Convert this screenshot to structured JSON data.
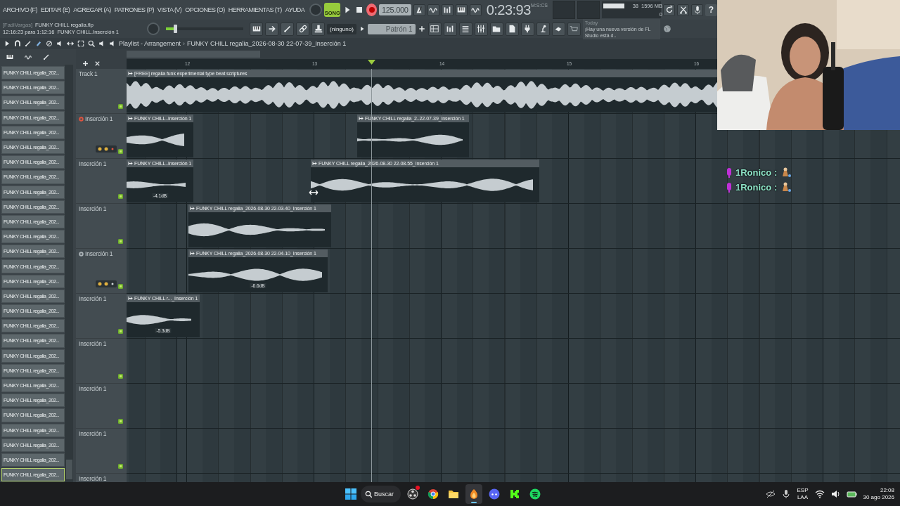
{
  "menu": [
    {
      "label": "ARCHIVO (F)"
    },
    {
      "label": "EDITAR (E)"
    },
    {
      "label": "AGREGAR (A)"
    },
    {
      "label": "PATRONES (P)"
    },
    {
      "label": "VISTA (V)"
    },
    {
      "label": "OPCIONES (O)"
    },
    {
      "label": "HERRAMIENTAS (T)"
    },
    {
      "label": "AYUDA"
    }
  ],
  "transport": {
    "mode": "SONG",
    "song_mode": true,
    "record_armed": true,
    "tempo": "125.000",
    "time": "0:23:93",
    "time_format": "M:S:CS"
  },
  "monitor": {
    "reading_1": "38",
    "memory": "1596 MB",
    "reading_2": "0"
  },
  "help": "?",
  "file": {
    "owner": "[FadiVargas]",
    "title": "FUNKY CHILL regalia.flp",
    "time_info": "12:16:23 para 1:12:16",
    "hint": "FUNKY CHILL.Inserción 1"
  },
  "main_slider": {
    "level": 0.12
  },
  "snap": "(ninguno)",
  "pattern": "Patrón 1",
  "news": {
    "day": "Today",
    "text": "¡Hay una nueva versión de FL Studio está d.."
  },
  "playlist": {
    "title": "Playlist - Arrangement",
    "separator": "›",
    "path": "FUNKY CHILL regalia_2026-08-30 22-07-39_Inserción 1",
    "bars": [
      "12",
      "13",
      "14",
      "15",
      "16"
    ],
    "tracks": [
      {
        "name": "Track 1",
        "clips": [
          {
            "label": "[FREE] regalia  funk  experimental type beat  scriptures"
          }
        ]
      },
      {
        "name": "Inserción 1",
        "record_armed": true,
        "clips": [
          {
            "label": "FUNKY CHILL..Inserción 1"
          },
          {
            "label": "FUNKY CHILL regalia_2..22-07-39_Inserción 1"
          }
        ]
      },
      {
        "name": "Inserción 1",
        "clips": [
          {
            "label": "FUNKY CHILL..Inserción 1",
            "gain": "-4.1dB"
          },
          {
            "label": "FUNKY CHILL regalia_2026-08-30 22-08-55_Inserción 1"
          }
        ]
      },
      {
        "name": "Inserción 1",
        "clips": [
          {
            "label": "FUNKY CHILL regalia_2026-08-30 22-03-40_Inserción 1"
          }
        ]
      },
      {
        "name": "Inserción 1",
        "record_armed": false,
        "clips": [
          {
            "label": "FUNKY CHILL regalia_2026-08-30 22-04-10_Inserción 1",
            "gain": "-6.6dB"
          }
        ]
      },
      {
        "name": "Inserción 1",
        "clips": [
          {
            "label": "FUNKY CHILL r..._Inserción 1",
            "gain": "-5.3dB"
          }
        ]
      },
      {
        "name": "Inserción 1"
      },
      {
        "name": "Inserción 1"
      },
      {
        "name": "Inserción 1"
      },
      {
        "name": "Inserción 1"
      }
    ]
  },
  "browser": {
    "items": [
      {
        "label": "FUNKY CHILL regalia_202...",
        "selected": false
      },
      {
        "label": "FUNKY CHILL regalia_202...",
        "selected": false
      },
      {
        "label": "FUNKY CHILL regalia_202...",
        "selected": false
      },
      {
        "label": "FUNKY CHILL regalia_202...",
        "selected": false
      },
      {
        "label": "FUNKY CHILL regalia_202...",
        "selected": false
      },
      {
        "label": "FUNKY CHILL regalia_202...",
        "selected": false
      },
      {
        "label": "FUNKY CHILL regalia_202...",
        "selected": false
      },
      {
        "label": "FUNKY CHILL regalia_202...",
        "selected": false
      },
      {
        "label": "FUNKY CHILL regalia_202...",
        "selected": false
      },
      {
        "label": "FUNKY CHILL regalia_202...",
        "selected": false
      },
      {
        "label": "FUNKY CHILL regalia_202...",
        "selected": false
      },
      {
        "label": "FUNKY CHILL regalia_202...",
        "selected": false
      },
      {
        "label": "FUNKY CHILL regalia_202...",
        "selected": false
      },
      {
        "label": "FUNKY CHILL regalia_202...",
        "selected": false
      },
      {
        "label": "FUNKY CHILL regalia_202...",
        "selected": false
      },
      {
        "label": "FUNKY CHILL regalia_202...",
        "selected": false
      },
      {
        "label": "FUNKY CHILL regalia_202...",
        "selected": false
      },
      {
        "label": "FUNKY CHILL regalia_202...",
        "selected": false
      },
      {
        "label": "FUNKY CHILL regalia_202...",
        "selected": false
      },
      {
        "label": "FUNKY CHILL regalia_202...",
        "selected": false
      },
      {
        "label": "FUNKY CHILL regalia_202...",
        "selected": false
      },
      {
        "label": "FUNKY CHILL regalia_202...",
        "selected": false
      },
      {
        "label": "FUNKY CHILL regalia_202...",
        "selected": false
      },
      {
        "label": "FUNKY CHILL regalia_202...",
        "selected": false
      },
      {
        "label": "FUNKY CHILL regalia_202...",
        "selected": false
      },
      {
        "label": "FUNKY CHILL regalia_202...",
        "selected": false
      },
      {
        "label": "FUNKY CHILL regalia_202...",
        "selected": false
      },
      {
        "label": "FUNKY CHILL regalia_202...",
        "selected": true
      }
    ]
  },
  "chat": [
    {
      "user": "1Ronico :"
    },
    {
      "user": "1Ronico :"
    }
  ],
  "taskbar": {
    "search": "Buscar",
    "apps": [
      {
        "kind": "capture",
        "selected": false,
        "badge": true
      },
      {
        "kind": "browser",
        "selected": false,
        "badge": false
      },
      {
        "kind": "folder",
        "selected": false,
        "badge": false
      },
      {
        "kind": "daw",
        "selected": true,
        "badge": false
      },
      {
        "kind": "chat",
        "selected": false,
        "badge": false
      },
      {
        "kind": "stream",
        "selected": false,
        "badge": false
      },
      {
        "kind": "music",
        "selected": false,
        "badge": false
      }
    ],
    "language": "ESP",
    "layout": "LAA",
    "time": "22:08",
    "date": "30 ago 2026"
  }
}
